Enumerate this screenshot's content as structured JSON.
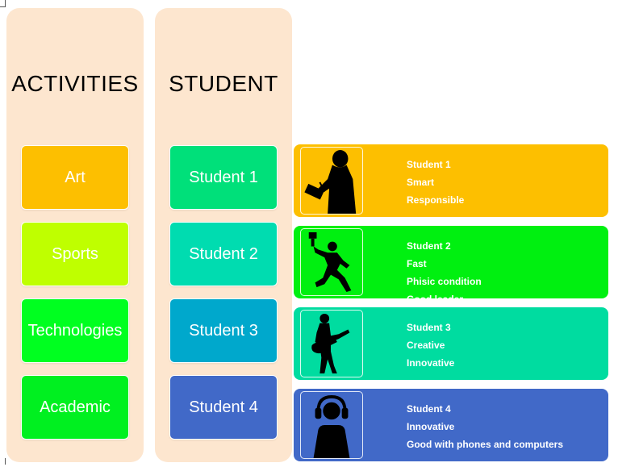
{
  "headers": {
    "activities": "ACTIVITIES",
    "student": "STUDENT"
  },
  "activities": [
    {
      "label": "Art",
      "color": "#fdbf00"
    },
    {
      "label": "Sports",
      "color": "#bfff00"
    },
    {
      "label": "Technologies",
      "color": "#00ff20"
    },
    {
      "label": "Academic",
      "color": "#00f020"
    }
  ],
  "students": [
    {
      "label": "Student 1",
      "color": "#00e07a"
    },
    {
      "label": "Student 2",
      "color": "#00dcb0"
    },
    {
      "label": "Student 3",
      "color": "#00a8cc"
    },
    {
      "label": "Student 4",
      "color": "#4169c8"
    }
  ],
  "profiles": [
    {
      "name": "Student 1",
      "traits": [
        "Smart",
        "Responsible"
      ],
      "color": "#fdbf00",
      "icon": "teacher-silhouette-icon"
    },
    {
      "name": "Student 2",
      "traits": [
        "Fast",
        "Phisic condition",
        "Good leader"
      ],
      "color": "#00f010",
      "icon": "runner-torch-silhouette-icon"
    },
    {
      "name": "Student 3",
      "traits": [
        "Creative",
        "Innovative"
      ],
      "color": "#00dca0",
      "icon": "guitarist-silhouette-icon"
    },
    {
      "name": "Student 4",
      "traits": [
        "Innovative",
        "Good with phones and computers"
      ],
      "color": "#4169c8",
      "icon": "headphones-person-icon"
    }
  ]
}
